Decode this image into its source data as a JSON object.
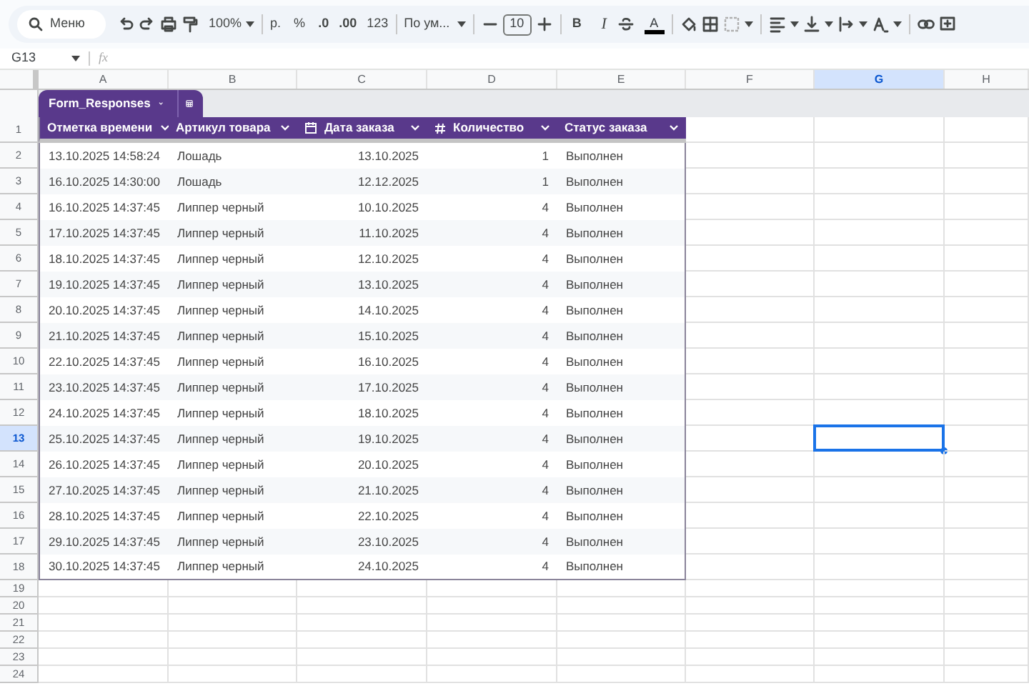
{
  "toolbar": {
    "search": "Меню",
    "zoom": "100%",
    "currency": "р.",
    "percent": "%",
    "decrease_decimals": ".0",
    "increase_decimals": ".00",
    "number_format": "123",
    "font": "По ум...",
    "font_size": "10",
    "bold": "B",
    "italic": "I",
    "text_color": "A"
  },
  "formula_bar": {
    "cell": "G13",
    "fx": "fx"
  },
  "columns": [
    {
      "label": "A",
      "selected": false
    },
    {
      "label": "B",
      "selected": false
    },
    {
      "label": "C",
      "selected": false
    },
    {
      "label": "D",
      "selected": false
    },
    {
      "label": "E",
      "selected": false
    },
    {
      "label": "F",
      "selected": false
    },
    {
      "label": "G",
      "selected": true
    },
    {
      "label": "H",
      "selected": false
    }
  ],
  "table": {
    "name": "Form_Responses",
    "headers": [
      {
        "label": "Отметка времени",
        "kind": "text"
      },
      {
        "label": "Артикул товара",
        "kind": "text"
      },
      {
        "label": "Дата заказа",
        "kind": "date"
      },
      {
        "label": "Количество",
        "kind": "number"
      },
      {
        "label": "Статус заказа",
        "kind": "text"
      }
    ],
    "rows": [
      [
        "13.10.2025 14:58:24",
        "Лошадь",
        "13.10.2025",
        "1",
        "Выполнен"
      ],
      [
        "16.10.2025 14:30:00",
        "Лошадь",
        "12.12.2025",
        "1",
        "Выполнен"
      ],
      [
        "16.10.2025 14:37:45",
        "Липпер черный",
        "10.10.2025",
        "4",
        "Выполнен"
      ],
      [
        "17.10.2025 14:37:45",
        "Липпер черный",
        "11.10.2025",
        "4",
        "Выполнен"
      ],
      [
        "18.10.2025 14:37:45",
        "Липпер черный",
        "12.10.2025",
        "4",
        "Выполнен"
      ],
      [
        "19.10.2025 14:37:45",
        "Липпер черный",
        "13.10.2025",
        "4",
        "Выполнен"
      ],
      [
        "20.10.2025 14:37:45",
        "Липпер черный",
        "14.10.2025",
        "4",
        "Выполнен"
      ],
      [
        "21.10.2025 14:37:45",
        "Липпер черный",
        "15.10.2025",
        "4",
        "Выполнен"
      ],
      [
        "22.10.2025 14:37:45",
        "Липпер черный",
        "16.10.2025",
        "4",
        "Выполнен"
      ],
      [
        "23.10.2025 14:37:45",
        "Липпер черный",
        "17.10.2025",
        "4",
        "Выполнен"
      ],
      [
        "24.10.2025 14:37:45",
        "Липпер черный",
        "18.10.2025",
        "4",
        "Выполнен"
      ],
      [
        "25.10.2025 14:37:45",
        "Липпер черный",
        "19.10.2025",
        "4",
        "Выполнен"
      ],
      [
        "26.10.2025 14:37:45",
        "Липпер черный",
        "20.10.2025",
        "4",
        "Выполнен"
      ],
      [
        "27.10.2025 14:37:45",
        "Липпер черный",
        "21.10.2025",
        "4",
        "Выполнен"
      ],
      [
        "28.10.2025 14:37:45",
        "Липпер черный",
        "22.10.2025",
        "4",
        "Выполнен"
      ],
      [
        "29.10.2025 14:37:45",
        "Липпер черный",
        "23.10.2025",
        "4",
        "Выполнен"
      ],
      [
        "30.10.2025 14:37:45",
        "Липпер черный",
        "24.10.2025",
        "4",
        "Выполнен"
      ]
    ]
  },
  "row_numbers": [
    {
      "label": "1",
      "selected": false
    },
    {
      "label": "2",
      "selected": false
    },
    {
      "label": "3",
      "selected": false
    },
    {
      "label": "4",
      "selected": false
    },
    {
      "label": "5",
      "selected": false
    },
    {
      "label": "6",
      "selected": false
    },
    {
      "label": "7",
      "selected": false
    },
    {
      "label": "8",
      "selected": false
    },
    {
      "label": "9",
      "selected": false
    },
    {
      "label": "10",
      "selected": false
    },
    {
      "label": "11",
      "selected": false
    },
    {
      "label": "12",
      "selected": false
    },
    {
      "label": "13",
      "selected": true
    },
    {
      "label": "14",
      "selected": false
    },
    {
      "label": "15",
      "selected": false
    },
    {
      "label": "16",
      "selected": false
    },
    {
      "label": "17",
      "selected": false
    },
    {
      "label": "18",
      "selected": false
    },
    {
      "label": "19",
      "selected": false
    },
    {
      "label": "20",
      "selected": false
    },
    {
      "label": "21",
      "selected": false
    },
    {
      "label": "22",
      "selected": false
    },
    {
      "label": "23",
      "selected": false
    },
    {
      "label": "24",
      "selected": false
    }
  ]
}
